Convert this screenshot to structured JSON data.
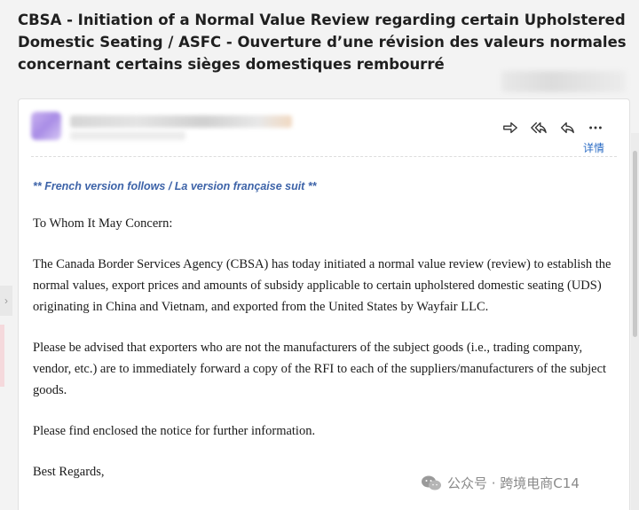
{
  "email": {
    "subject": "CBSA - Initiation of a Normal Value Review regarding certain Upholstered Domestic Seating / ASFC - Ouverture d’une révision des valeurs normales concernant certains sièges domestiques rembourré",
    "details_link": "详情",
    "actions": {
      "forward_icon": "forward-arrow-icon",
      "reply_all_icon": "reply-all-icon",
      "reply_icon": "reply-icon",
      "more_icon": "more-horizontal-icon"
    },
    "body": {
      "language_notice": "** French version follows / La version française suit **",
      "greeting": "To Whom It May Concern:",
      "paragraph_1": "The Canada Border Services Agency (CBSA) has today initiated a normal value review (review) to establish the normal values, export prices and amounts of subsidy applicable to certain upholstered domestic seating (UDS) originating in China and Vietnam, and exported from the United States by Wayfair LLC.",
      "paragraph_2": "Please be advised that exporters who are not the manufacturers of the subject goods (i.e., trading company, vendor, etc.) are to immediately forward a copy of the RFI to each of the suppliers/manufacturers of the subject goods.",
      "paragraph_3": "Please find enclosed the notice for further information.",
      "closing": "Best Regards,"
    }
  },
  "watermark": {
    "text": "公众号 · 跨境电商C14",
    "icon": "wechat-icon"
  },
  "colors": {
    "link": "#2a6bc4",
    "notice": "#3d63a8",
    "background": "#f3f3f3"
  }
}
